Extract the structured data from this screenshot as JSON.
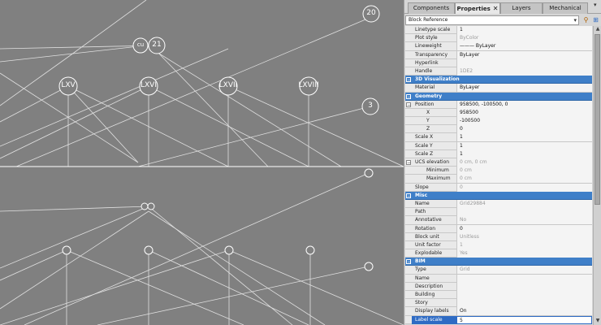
{
  "viewport": {
    "grid_labels_upper": [
      "20",
      "cu",
      "21",
      "LXV",
      "LXVI",
      "LXVII",
      "LXVIII",
      "3"
    ]
  },
  "panel": {
    "tabs": [
      "Components",
      "Properties",
      "Layers",
      "Mechanical Bro..."
    ],
    "active_tab": "Properties",
    "selection": "Block Reference",
    "rows": [
      {
        "type": "prop",
        "name": "Linetype scale",
        "value": "1"
      },
      {
        "type": "prop",
        "name": "Plot style",
        "value": "ByColor",
        "dim": true
      },
      {
        "type": "prop",
        "name": "Lineweight",
        "value": "——— ByLayer"
      },
      {
        "type": "prop",
        "name": "Transparency",
        "value": "ByLayer"
      },
      {
        "type": "prop",
        "name": "Hyperlink",
        "value": ""
      },
      {
        "type": "prop",
        "name": "Handle",
        "value": "1DE2",
        "dim": true
      },
      {
        "type": "header",
        "name": "3D Visualization"
      },
      {
        "type": "prop",
        "name": "Material",
        "value": "ByLayer"
      },
      {
        "type": "header",
        "name": "Geometry"
      },
      {
        "type": "prop",
        "name": "Position",
        "value": "958500, -100500, 0",
        "toggle": "−"
      },
      {
        "type": "prop",
        "name": "X",
        "value": "958500",
        "indent": true
      },
      {
        "type": "prop",
        "name": "Y",
        "value": "-100500",
        "indent": true
      },
      {
        "type": "prop",
        "name": "Z",
        "value": "0",
        "indent": true
      },
      {
        "type": "prop",
        "name": "Scale X",
        "value": "1"
      },
      {
        "type": "prop",
        "name": "Scale Y",
        "value": "1"
      },
      {
        "type": "prop",
        "name": "Scale Z",
        "value": "1"
      },
      {
        "type": "prop",
        "name": "UCS elevation",
        "value": "0 cm, 0 cm",
        "dim": true,
        "toggle": "−"
      },
      {
        "type": "prop",
        "name": "Minimum",
        "value": "0 cm",
        "dim": true,
        "indent": true
      },
      {
        "type": "prop",
        "name": "Maximum",
        "value": "0 cm",
        "dim": true,
        "indent": true
      },
      {
        "type": "prop",
        "name": "Slope",
        "value": "0",
        "dim": true
      },
      {
        "type": "header",
        "name": "Misc"
      },
      {
        "type": "prop",
        "name": "Name",
        "value": "Grid29884",
        "dim": true
      },
      {
        "type": "prop",
        "name": "Path",
        "value": ""
      },
      {
        "type": "prop",
        "name": "Annotative",
        "value": "No",
        "dim": true
      },
      {
        "type": "prop",
        "name": "Rotation",
        "value": "0"
      },
      {
        "type": "prop",
        "name": "Block unit",
        "value": "Unitless",
        "dim": true
      },
      {
        "type": "prop",
        "name": "Unit factor",
        "value": "1",
        "dim": true
      },
      {
        "type": "prop",
        "name": "Explodable",
        "value": "Yes",
        "dim": true
      },
      {
        "type": "header",
        "name": "BIM"
      },
      {
        "type": "prop",
        "name": "Type",
        "value": "Grid",
        "dim": true
      },
      {
        "type": "prop",
        "name": "Name",
        "value": ""
      },
      {
        "type": "prop",
        "name": "Description",
        "value": ""
      },
      {
        "type": "prop",
        "name": "Building",
        "value": ""
      },
      {
        "type": "prop",
        "name": "Story",
        "value": ""
      },
      {
        "type": "prop",
        "name": "Display labels",
        "value": "On"
      },
      {
        "type": "prop",
        "name": "Label scale",
        "value": "5",
        "selected": true
      }
    ]
  }
}
